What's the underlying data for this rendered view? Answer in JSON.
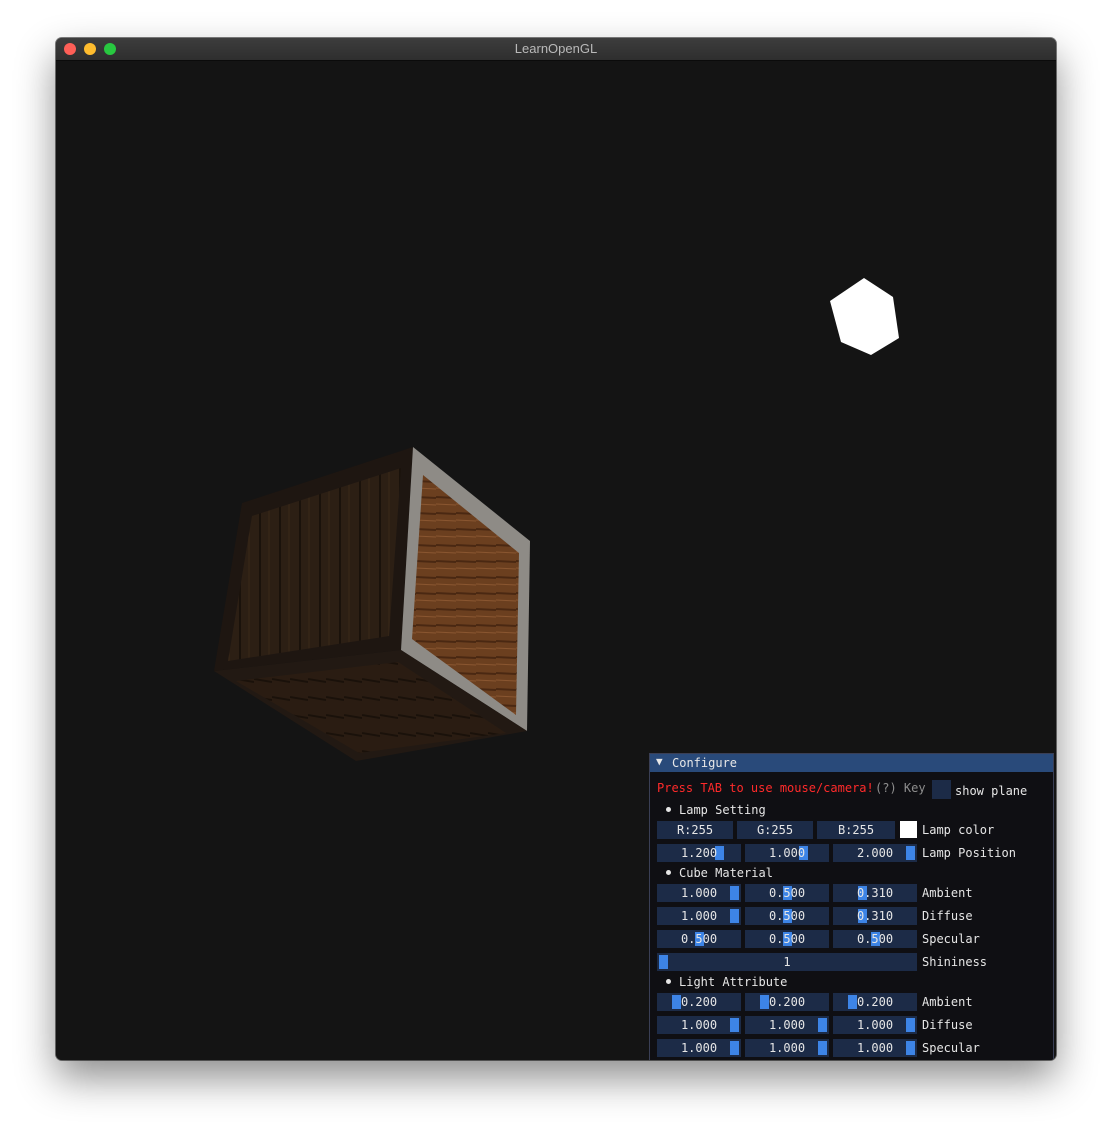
{
  "window": {
    "title": "LearnOpenGL"
  },
  "panel": {
    "title": "Configure",
    "collapse_arrow": "▼",
    "tab_hint": "Press TAB to use mouse/camera!",
    "help_marker": "(?) Key",
    "show_plane_label": "show plane",
    "sections": {
      "lamp": "Lamp Setting",
      "cube": "Cube Material",
      "light": "Light Attribute"
    },
    "lamp_color": {
      "r": "R:255",
      "g": "G:255",
      "b": "B:255",
      "label": "Lamp color",
      "swatch": "#ffffff"
    },
    "lamp_position": {
      "values": [
        "1.200",
        "1.000",
        "2.000"
      ],
      "label": "Lamp Position"
    },
    "cube_material": {
      "ambient": {
        "values": [
          "1.000",
          "0.500",
          "0.310"
        ],
        "label": "Ambient"
      },
      "diffuse": {
        "values": [
          "1.000",
          "0.500",
          "0.310"
        ],
        "label": "Diffuse"
      },
      "specular": {
        "values": [
          "0.500",
          "0.500",
          "0.500"
        ],
        "label": "Specular"
      },
      "shininess": {
        "value": "1",
        "label": "Shininess"
      }
    },
    "light_attribute": {
      "ambient": {
        "values": [
          "0.200",
          "0.200",
          "0.200"
        ],
        "label": "Ambient"
      },
      "diffuse": {
        "values": [
          "1.000",
          "1.000",
          "1.000"
        ],
        "label": "Diffuse"
      },
      "specular": {
        "values": [
          "1.000",
          "1.000",
          "1.000"
        ],
        "label": "Specular"
      }
    }
  },
  "colors": {
    "title_bar_active": "#294a7a",
    "frame_bg": "#1c2b47",
    "slider_grab": "#3d84e6",
    "warning_text": "#ff2a2a",
    "lamp": "#ffffff"
  }
}
